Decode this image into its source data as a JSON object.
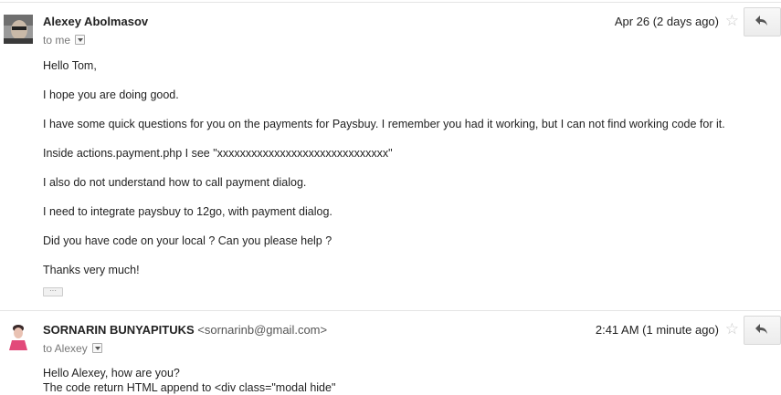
{
  "messages": [
    {
      "sender_name": "Alexey Abolmasov",
      "sender_email": "",
      "recipient": "to me",
      "date": "Apr 26 (2 days ago)",
      "star_icon": "star-icon",
      "reply_icon": "reply-icon",
      "body": [
        "Hello Tom,",
        "I hope you are doing good.",
        "I have some quick questions for you on the payments for Paysbuy. I remember you had it working, but I can not find working code for it.",
        "Inside actions.payment.php I see \"xxxxxxxxxxxxxxxxxxxxxxxxxxxxxx\"",
        "I also do not understand how to call payment dialog.",
        "I need to integrate paysbuy to 12go, with payment dialog.",
        "Did you have code on your local ? Can you please help  ?",
        "Thanks very much!"
      ],
      "trimmed_content_label": "···"
    },
    {
      "sender_name": "SORNARIN BUNYAPITUKS",
      "sender_email": "<sornarinb@gmail.com>",
      "recipient": "to Alexey",
      "date": "2:41 AM (1 minute ago)",
      "star_icon": "star-icon",
      "reply_icon": "reply-icon",
      "body": [
        "Hello Alexey, how are you?",
        "The code return HTML append to <div class=\"modal hide\""
      ]
    }
  ]
}
